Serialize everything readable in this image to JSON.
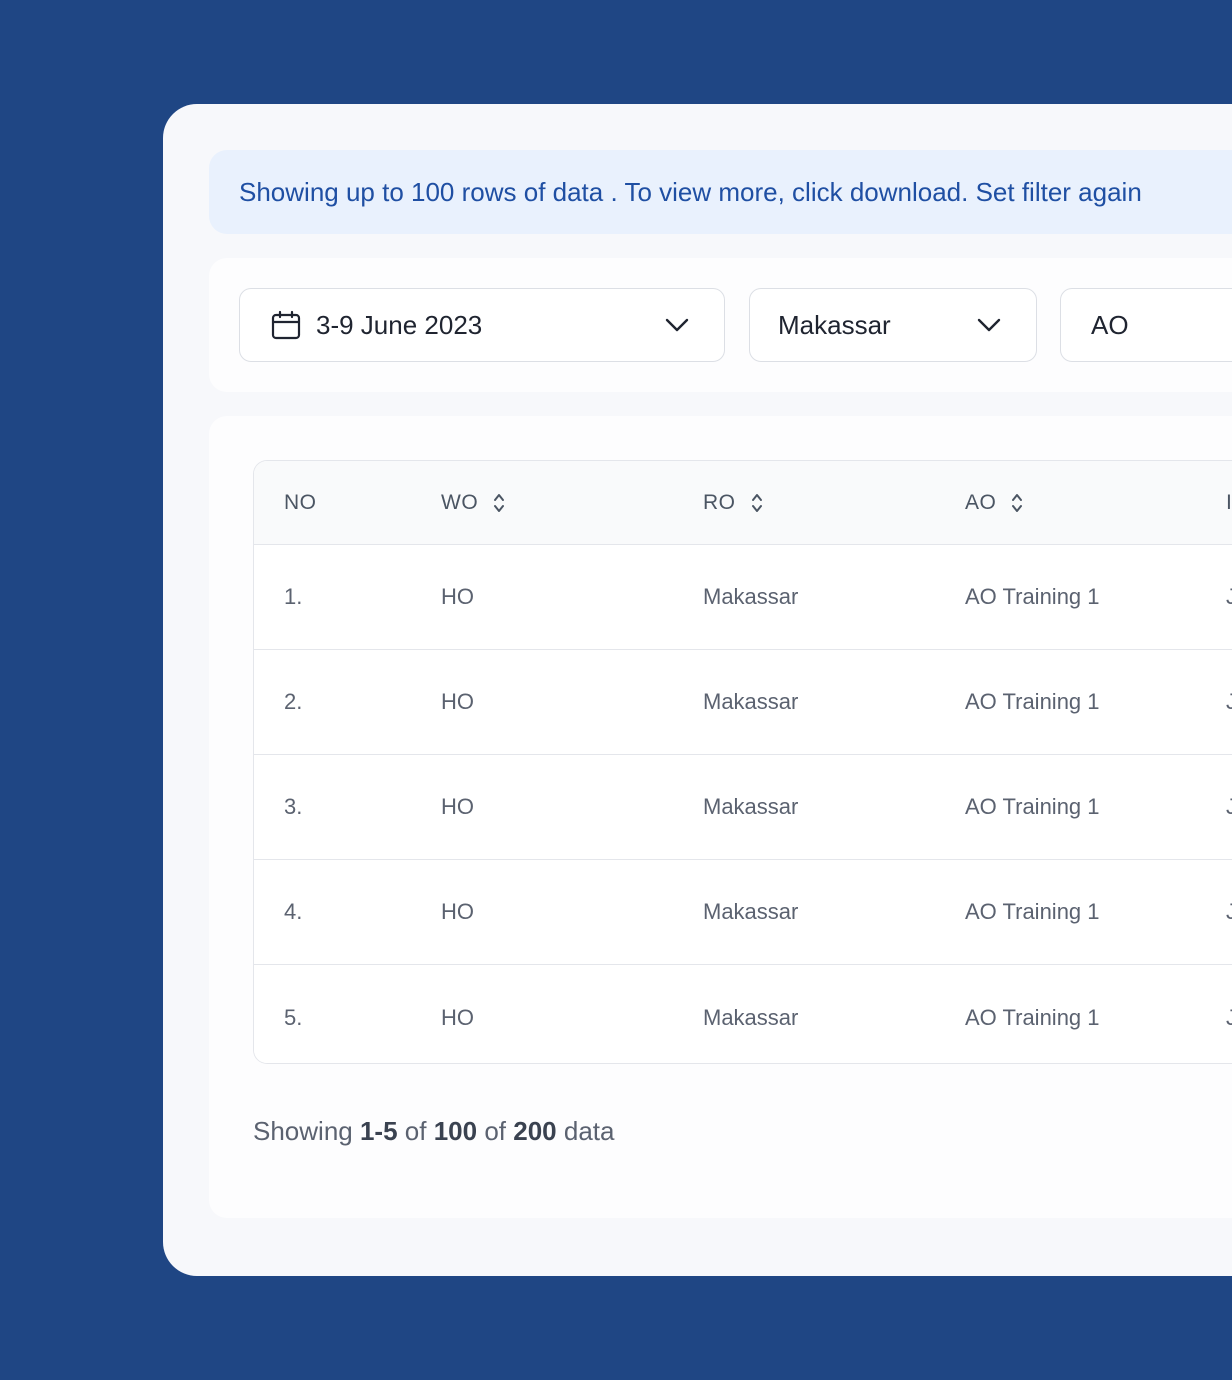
{
  "notice": {
    "text": "Showing up to 100 rows of data . To view more, click download. Set filter again"
  },
  "filters": {
    "date_value": "3-9 June 2023",
    "region_value": "Makassar",
    "ao_value": "AO"
  },
  "table": {
    "columns": [
      "NO",
      "WO",
      "RO",
      "AO",
      "I"
    ],
    "rows": [
      {
        "no": "1.",
        "wo": "HO",
        "ro": "Makassar",
        "ao": "AO Training 1",
        "extra": "J"
      },
      {
        "no": "2.",
        "wo": "HO",
        "ro": "Makassar",
        "ao": "AO Training 1",
        "extra": "J"
      },
      {
        "no": "3.",
        "wo": "HO",
        "ro": "Makassar",
        "ao": "AO Training 1",
        "extra": "J"
      },
      {
        "no": "4.",
        "wo": "HO",
        "ro": "Makassar",
        "ao": "AO Training 1",
        "extra": "J"
      },
      {
        "no": "5.",
        "wo": "HO",
        "ro": "Makassar",
        "ao": "AO Training 1",
        "extra": "J"
      }
    ]
  },
  "pagination": {
    "prefix": "Showing",
    "range": "1-5",
    "of1": "of",
    "shown": "100",
    "of2": "of",
    "total": "200",
    "suffix": "data"
  },
  "icons": {
    "calendar": "calendar-icon",
    "chevron": "chevron-down-icon",
    "sort": "sort-icon"
  },
  "colors": {
    "background": "#1f4684",
    "notice_text": "#1f4fa3",
    "notice_bg": "#e9f1fd"
  }
}
